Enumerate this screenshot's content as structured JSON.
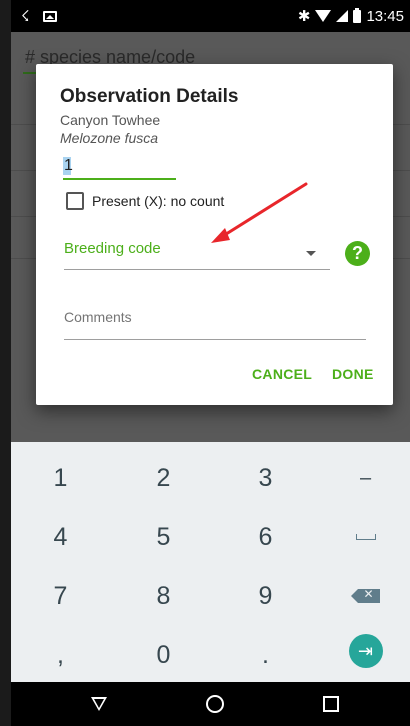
{
  "status_bar": {
    "time": "13:45"
  },
  "app": {
    "search_placeholder": "# species name/code"
  },
  "dialog": {
    "title": "Observation Details",
    "common_name": "Canyon Towhee",
    "scientific_name": "Melozone fusca",
    "count_value": "1",
    "present_label": "Present (X): no count",
    "breeding_code_label": "Breeding code",
    "help_glyph": "?",
    "comments_placeholder": "Comments",
    "cancel_label": "CANCEL",
    "done_label": "DONE"
  },
  "keyboard": {
    "rows": [
      [
        "1",
        "2",
        "3",
        "–"
      ],
      [
        "4",
        "5",
        "6",
        "space"
      ],
      [
        "7",
        "8",
        "9",
        "backspace"
      ],
      [
        ",",
        "0",
        ".",
        "next"
      ]
    ],
    "labels": {
      "k1": "1",
      "k2": "2",
      "k3": "3",
      "minus": "–",
      "k4": "4",
      "k5": "5",
      "k6": "6",
      "k7": "7",
      "k8": "8",
      "k9": "9",
      "comma": ",",
      "k0": "0",
      "period": "."
    }
  },
  "colors": {
    "accent_green": "#4caf1a",
    "annotation_red": "#e8262b",
    "keyboard_bg": "#eceff1",
    "next_key_teal": "#26a69a"
  },
  "icons": {
    "status": [
      "usb-debug-icon",
      "image-notification-icon",
      "bluetooth-icon",
      "wifi-icon",
      "signal-icon",
      "battery-icon"
    ],
    "nav": [
      "back-icon",
      "home-icon",
      "recents-icon"
    ]
  }
}
